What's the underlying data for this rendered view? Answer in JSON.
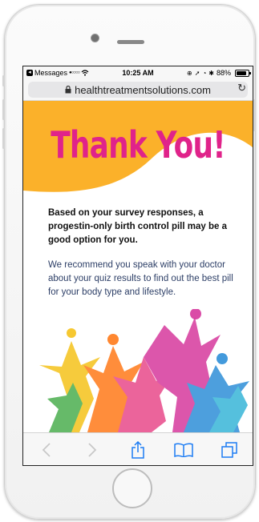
{
  "status_bar": {
    "carrier": "Messages",
    "signal": "●○○○○",
    "time": "10:25 AM",
    "battery": "88%",
    "battery_level": 0.88
  },
  "browser": {
    "url": "healthtreatmentsolutions.com"
  },
  "page": {
    "heading": "Thank You!",
    "result_text": "Based on your survey responses, a progestin-only birth control pill may be a good option for you.",
    "recommend_text": "We recommend you speak with your doctor about your quiz results to find out the best pill for your body type and lifestyle."
  },
  "colors": {
    "banner": "#fbb12a",
    "heading": "#e0238a",
    "recommend": "#2c3e66",
    "toolbar_icon": "#1c7cf4"
  },
  "toolbar": {
    "back_icon": "chevron-left-icon",
    "forward_icon": "chevron-right-icon",
    "share_icon": "share-icon",
    "bookmarks_icon": "book-icon",
    "tabs_icon": "tabs-icon"
  }
}
